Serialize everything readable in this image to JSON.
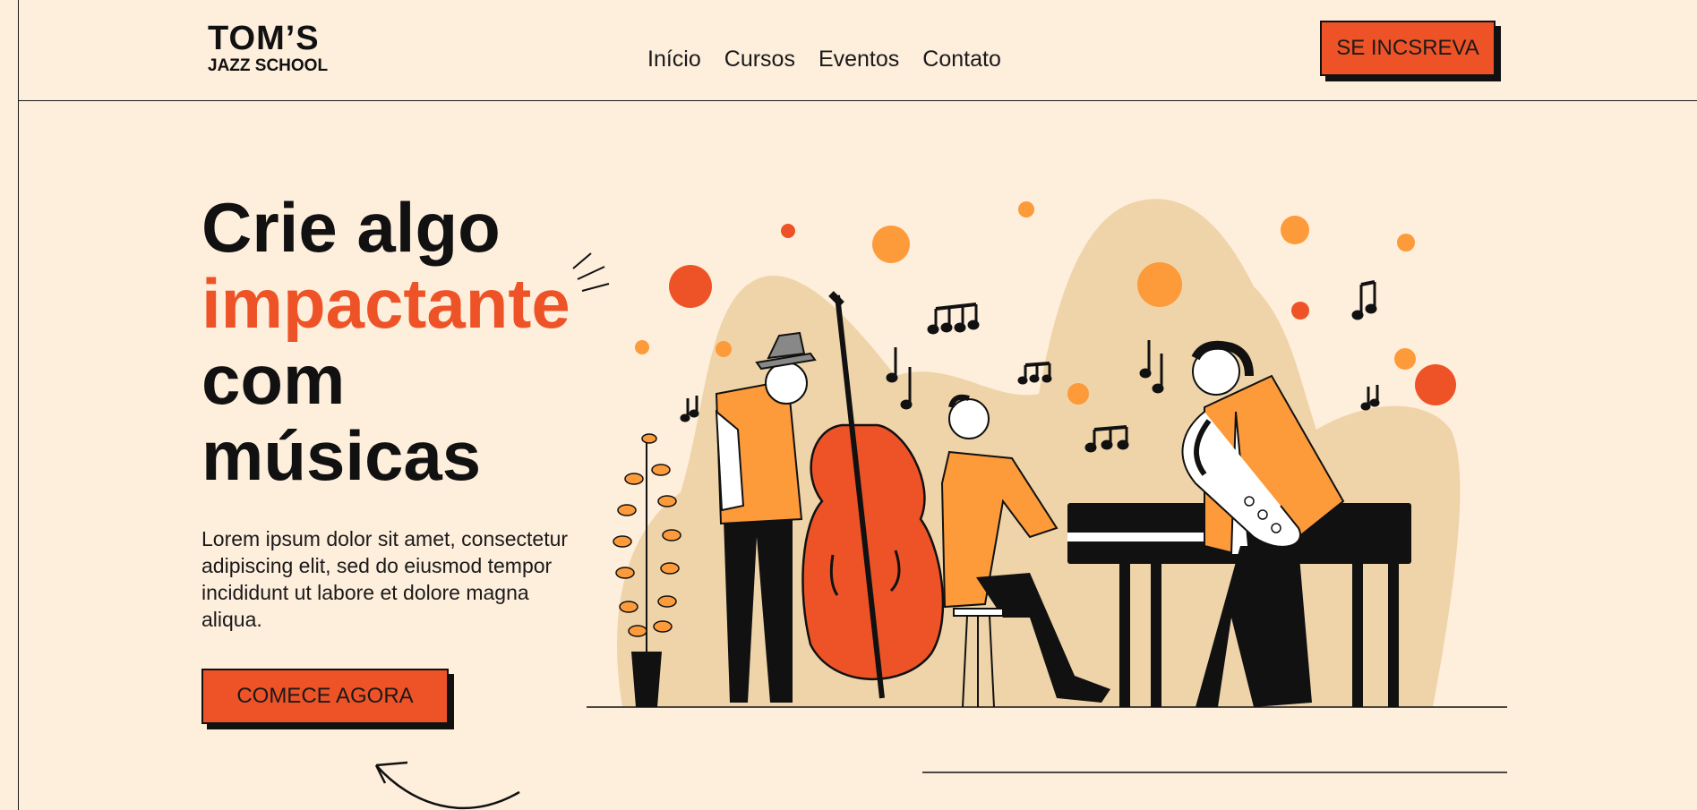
{
  "header": {
    "logo_main": "TOM’S",
    "logo_sub": "JAZZ SCHOOL",
    "nav": [
      {
        "label": "Início"
      },
      {
        "label": "Cursos"
      },
      {
        "label": "Eventos"
      },
      {
        "label": "Contato"
      }
    ],
    "signup_label": "SE INCSREVA"
  },
  "hero": {
    "title_line1": "Crie algo",
    "title_line2": "impactante",
    "title_line3": "com",
    "title_line4": "músicas",
    "description": "Lorem ipsum dolor sit amet, consectetur adipiscing elit, sed do eiusmod tempor incididunt ut labore et dolore magna aliqua.",
    "cta_label": "COMECE AGORA"
  },
  "colors": {
    "background": "#feeedc",
    "accent": "#ee5327",
    "orange": "#fd9a3a",
    "blob": "#efd4a9",
    "ink": "#111111"
  },
  "illustration": {
    "icons": [
      "jazz-band-illustration",
      "music-note-icon",
      "double-bass-icon",
      "piano-icon",
      "saxophone-icon",
      "plant-icon"
    ]
  }
}
